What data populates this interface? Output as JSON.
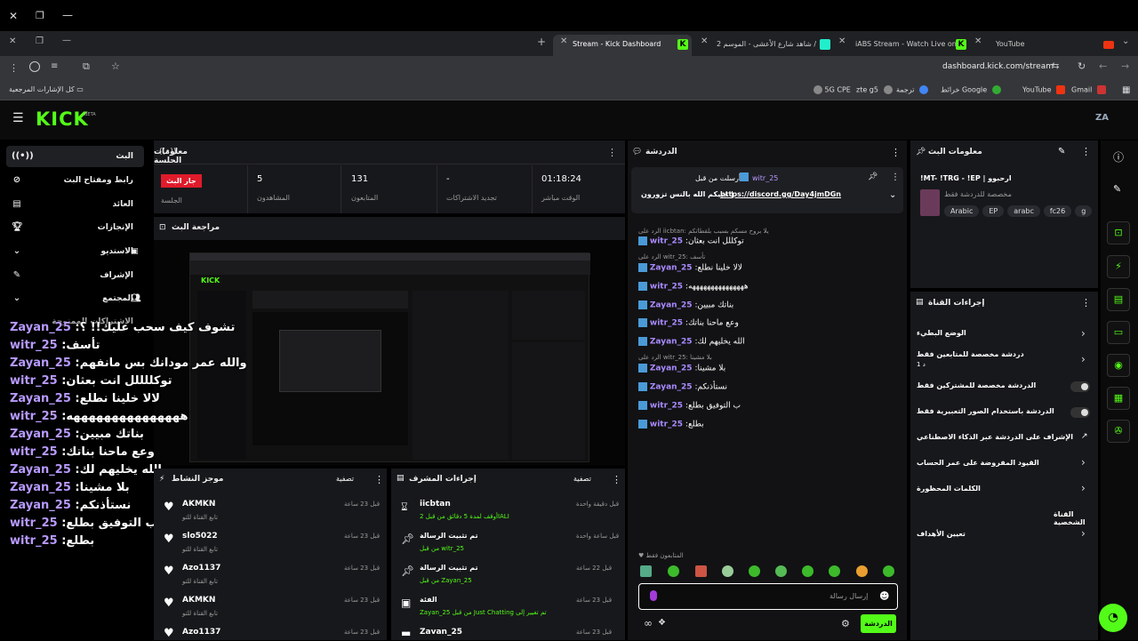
{
  "browser": {
    "tabs": [
      {
        "title": "YouTube",
        "icon": "youtube-icon"
      },
      {
        "title": "iABS Stream - Watch Live on Ki",
        "icon": "kick-icon"
      },
      {
        "title": "شاهد شارع الأعشى - الموسم 2 /",
        "icon": "shahid-icon"
      },
      {
        "title": "Stream - Kick Dashboard",
        "icon": "kick-icon"
      }
    ],
    "url": "dashboard.kick.com/stream",
    "bookmarks": [
      "Gmail",
      "YouTube",
      "خرائط Google",
      "ترجمة",
      "zte g5",
      "5G CPE"
    ],
    "all_bookmarks": "كل الإشارات المرجعية"
  },
  "header": {
    "logo": "KICK",
    "beta": "BETA",
    "avatar": "ZA"
  },
  "sidebar": {
    "items": [
      {
        "label": "البث",
        "icon": "broadcast-icon"
      },
      {
        "label": "رابط ومفتاح البث",
        "icon": "link-icon"
      },
      {
        "label": "العائد",
        "icon": "revenue-icon"
      },
      {
        "label": "الإنجازات",
        "icon": "trophy-icon"
      },
      {
        "label": "الاستديو",
        "icon": "chevron-down-icon"
      },
      {
        "label": "الإشراف",
        "icon": "wrench-icon"
      },
      {
        "label": "المجتمع",
        "icon": "chevron-down-icon"
      }
    ],
    "partial": "الاشتراكات الممنوحة"
  },
  "session": {
    "title": "معلومات الجلسة",
    "live_badge": "جار البث",
    "stats": [
      {
        "value": "",
        "label": "الجلسة"
      },
      {
        "value": "5",
        "label": "المشاهدون"
      },
      {
        "value": "131",
        "label": "المتابعون"
      },
      {
        "value": "-",
        "label": "تجديد الاشتراكات"
      },
      {
        "value": "01:18:24",
        "label": "الوقت مباشر"
      }
    ]
  },
  "preview": {
    "title": "مراجعة البث"
  },
  "overlay_chat": [
    {
      "name": "Zayan_25",
      "text": "تشوف كيف سحب عليك!! ؟"
    },
    {
      "name": "witr_25",
      "text": "تأسف"
    },
    {
      "name": "Zayan_25",
      "text": "والله عمر مودانك بس مانفهم"
    },
    {
      "name": "witr_25",
      "text": "توكللللل انت بعثان"
    },
    {
      "name": "Zayan_25",
      "text": "لالا خلينا نطلع"
    },
    {
      "name": "witr_25",
      "text": "هههههههههههههههه"
    },
    {
      "name": "Zayan_25",
      "text": "بناتك مبيين"
    },
    {
      "name": "witr_25",
      "text": "وعع ماحنا بناتك"
    },
    {
      "name": "Zayan_25",
      "text": "الله يخليهم لك"
    },
    {
      "name": "Zayan_25",
      "text": "بلا مشينا"
    },
    {
      "name": "Zayan_25",
      "text": "نستأذنكم"
    },
    {
      "name": "witr_25",
      "text": "ب التوفيق بطلع"
    },
    {
      "name": "witr_25",
      "text": "بطلع"
    }
  ],
  "activity": {
    "title": "موجز النشاط",
    "filter": "تصفية",
    "items": [
      {
        "name": "AKMKN",
        "sub": "تابع القناة للتو",
        "time": "قبل 23 ساعة"
      },
      {
        "name": "slo5022",
        "sub": "تابع القناة للتو",
        "time": "قبل 23 ساعة"
      },
      {
        "name": "Azo1137",
        "sub": "تابع القناة للتو",
        "time": "قبل 23 ساعة"
      },
      {
        "name": "AKMKN",
        "sub": "تابع القناة للتو",
        "time": "قبل 23 ساعة"
      },
      {
        "name": "Azo1137",
        "sub": "",
        "time": "قبل 23 ساعة"
      }
    ]
  },
  "modactions": {
    "title": "إجراءات المشرف",
    "filter": "تصفية",
    "items": [
      {
        "name": "iicbtan",
        "sub": "أوقف لمدة 5 دقائق من قبل 2IALI",
        "time": "قبل دقيقة واحدة",
        "icon": "hourglass-icon"
      },
      {
        "name": "تم تثبيت الرسالة",
        "sub": "من قبل witr_25",
        "time": "قبل ساعة واحدة",
        "icon": "pin-icon"
      },
      {
        "name": "تم تثبيت الرسالة",
        "sub": "من قبل Zayan_25",
        "time": "قبل 22 ساعة",
        "icon": "pin-icon"
      },
      {
        "name": "الفئة",
        "sub": "Zayan_25 من قبل Just Chatting تم تغيير إلى",
        "time": "قبل 23 ساعة",
        "icon": "category-icon"
      },
      {
        "name": "Zavan_25",
        "sub": "",
        "time": "قبل 23 ساعة",
        "icon": "user-icon"
      }
    ]
  },
  "chat": {
    "title": "الدردشة",
    "pinned_by": "أرسلت من قبل",
    "pinned_user": "witr_25",
    "pinned_text": "حييكم الله بالنس تزورون |",
    "pinned_link": "https://discord.gg/Day4jmDGn",
    "messages": [
      {
        "type": "reply",
        "text": "الرد على iicbtan: يلا بروح مسكم بسبب بلقطاتكم"
      },
      {
        "type": "msg",
        "name": "witr_25",
        "text": "توكللل انت بعثان"
      },
      {
        "type": "reply",
        "text": "الرد على witr_25: تأسف"
      },
      {
        "type": "msg",
        "name": "Zayan_25",
        "text": "لالا خلينا نطلع"
      },
      {
        "type": "msg",
        "name": "witr_25",
        "text": "هههههههههههههههه"
      },
      {
        "type": "msg",
        "name": "Zayan_25",
        "text": "بناتك مبيين"
      },
      {
        "type": "msg",
        "name": "witr_25",
        "text": "وعع ماحنا بناتك"
      },
      {
        "type": "msg",
        "name": "Zayan_25",
        "text": "الله يخليهم لك"
      },
      {
        "type": "reply",
        "text": "الرد على witr_25: بلا مشينا"
      },
      {
        "type": "msg",
        "name": "Zayan_25",
        "text": "بلا مشينا"
      },
      {
        "type": "msg",
        "name": "Zayan_25",
        "text": "نستأذنكم"
      },
      {
        "type": "msg",
        "name": "witr_25",
        "text": "ب التوفيق بطلع"
      },
      {
        "type": "msg",
        "name": "witr_25",
        "text": "بطلع"
      }
    ],
    "followers_only": "المتابعون فقط",
    "placeholder": "إرسال رسالة",
    "send_label": "الدردشة"
  },
  "streaminfo": {
    "title": "معلومات البث",
    "stream_title": "!MT- !TRG - !EP | ارحبوو",
    "subtitle": "مخصصة للدردشة فقط",
    "tags": [
      "Arabic",
      "EP",
      "arabc",
      "fc26",
      "g"
    ]
  },
  "channel": {
    "title": "إجراءات القناة",
    "items": [
      {
        "label": "الوضع البطيء",
        "sub": "",
        "control": "chevron"
      },
      {
        "label": "دردشة مخصصة للمتابعين فقط",
        "sub": "1 د",
        "control": "chevron"
      },
      {
        "label": "الدردشة مخصصة للمشتركين فقط",
        "sub": "",
        "control": "toggle"
      },
      {
        "label": "الدردشة باستخدام الصور التعبيرية فقط",
        "sub": "",
        "control": "toggle"
      },
      {
        "label": "الإشراف على الدردشة عبر الذكاء الاصطناعي",
        "sub": "",
        "control": "link"
      },
      {
        "label": "القيود المفروضة على عمر الحساب",
        "sub": "",
        "control": "chevron"
      },
      {
        "label": "الكلمات المحظورة",
        "sub": "",
        "control": "chevron"
      },
      {
        "label": "القناة الشخصية",
        "sub": "",
        "control": "none"
      },
      {
        "label": "تعيين الأهداف",
        "sub": "",
        "control": "chevron"
      }
    ]
  }
}
